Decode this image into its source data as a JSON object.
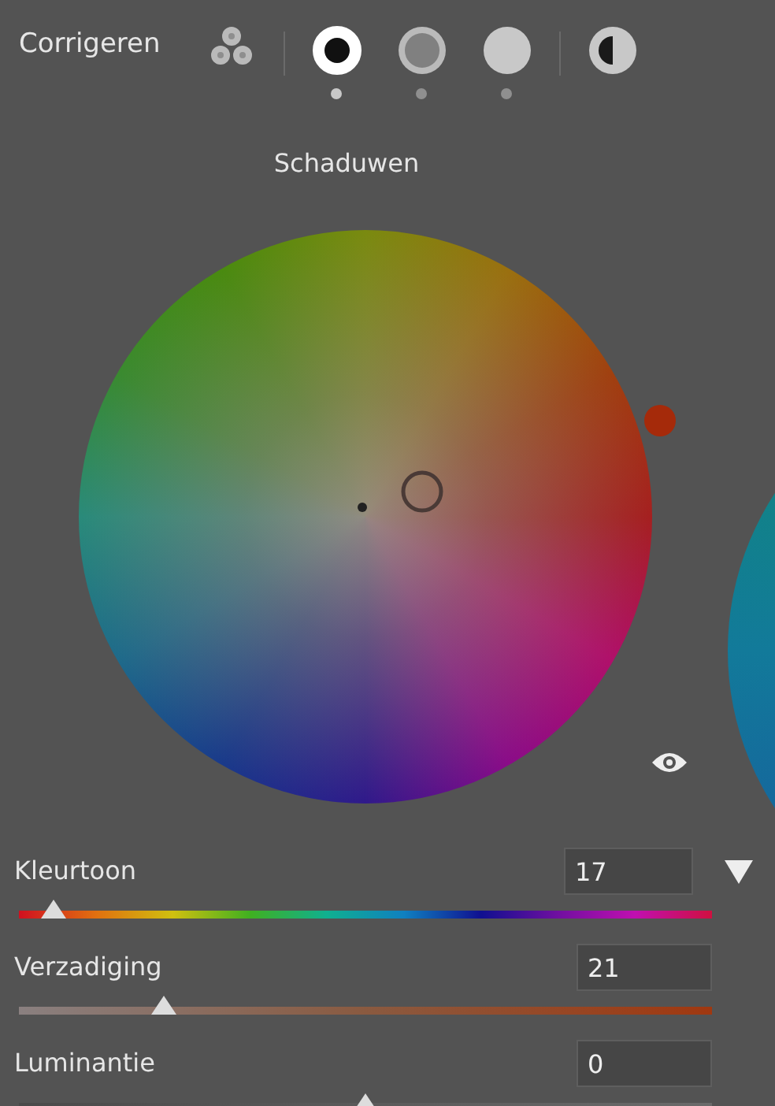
{
  "panel": {
    "title": "Corrigeren"
  },
  "modes": [
    {
      "kind": "three-way",
      "selected": false
    },
    {
      "kind": "shadows",
      "selected": true
    },
    {
      "kind": "midtones",
      "selected": false
    },
    {
      "kind": "highlights",
      "selected": false
    },
    {
      "kind": "global",
      "selected": false
    }
  ],
  "wheel": {
    "title": "Schaduwen"
  },
  "sliders": [
    {
      "kind": "hue",
      "label": "Kleurtoon",
      "value": "17",
      "level": 0.05,
      "menu": true
    },
    {
      "kind": "saturation",
      "label": "Verzadiging",
      "value": "21",
      "level": 0.21,
      "menu": false
    },
    {
      "kind": "luminance",
      "label": "Luminantie",
      "value": "0",
      "level": 0.5,
      "menu": false
    }
  ]
}
